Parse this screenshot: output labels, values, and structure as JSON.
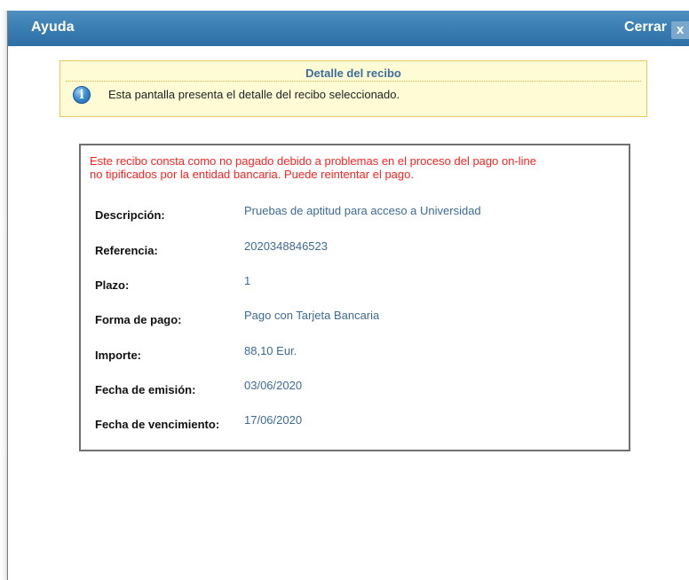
{
  "dialog": {
    "title": "Ayuda",
    "close_label": "Cerrar",
    "close_icon": "x"
  },
  "info": {
    "title": "Detalle del recibo",
    "message": "Esta pantalla presenta el detalle del recibo seleccionado.",
    "icon": "i"
  },
  "receipt": {
    "warning_line1": "Este recibo consta como no pagado debido a problemas en el proceso del pago on-line",
    "warning_line2": "no tipificados por la entidad bancaria. Puede reintentar el pago.",
    "fields": [
      {
        "label": "Descripción:",
        "value": "Pruebas de aptitud para acceso a Universidad"
      },
      {
        "label": "Referencia:",
        "value": "2020348846523"
      },
      {
        "label": "Plazo:",
        "value": "1"
      },
      {
        "label": "Forma de pago:",
        "value": "Pago con Tarjeta Bancaria"
      },
      {
        "label": "Importe:",
        "value": "88,10 Eur."
      },
      {
        "label": "Fecha de emisión:",
        "value": "03/06/2020"
      },
      {
        "label": "Fecha de vencimiento:",
        "value": "17/06/2020"
      }
    ]
  },
  "colors": {
    "titlebar": "#3b7fb4",
    "warning": "#ff2222",
    "value_text": "#3d6a95",
    "info_background": "#fffbd5"
  }
}
